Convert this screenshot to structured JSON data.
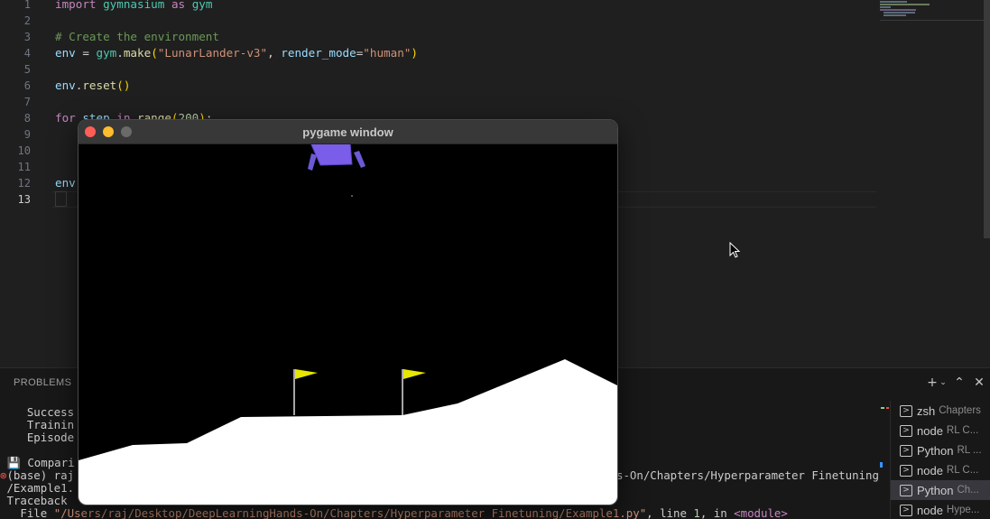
{
  "editor": {
    "line_numbers": [
      "1",
      "2",
      "3",
      "4",
      "5",
      "6",
      "7",
      "8",
      "9",
      "10",
      "11",
      "12",
      "13"
    ],
    "active_line": "13",
    "lines": {
      "l1": {
        "kw": "import",
        "mod": "gymnasium",
        "as": "as",
        "alias": "gym"
      },
      "l3": {
        "comment": "# Create the environment"
      },
      "l4": {
        "var": "env",
        "eq": " = ",
        "obj": "gym",
        "dot": ".",
        "fn": "make",
        "open": "(",
        "str1": "\"LunarLander-v3\"",
        "comma": ", ",
        "kw": "render_mode",
        "eq2": "=",
        "str2": "\"human\"",
        "close": ")"
      },
      "l6": {
        "var": "env",
        "dot": ".",
        "fn": "reset",
        "parens": "()"
      },
      "l8": {
        "kw": "for",
        "var": " step ",
        "in": "in",
        "fn": " range",
        "open": "(",
        "num": "200",
        "close": ")",
        "colon": ":"
      },
      "l12": {
        "var": "env"
      }
    }
  },
  "panel": {
    "tab_label": "PROBLEMS",
    "actions": {
      "add": "+",
      "dropdown": "⌄",
      "maximize": "⌃",
      "close": "✕"
    },
    "terminal_lines": [
      "    Success",
      "    Trainin",
      "    Episode",
      "",
      " 💾 Compari"
    ],
    "prompt": {
      "dot": "⊗",
      "text": "(base) raj",
      "tail": "s-On/Chapters/Hyperparameter Finetuning"
    },
    "cont": " /Example1.",
    "traceback": " Traceback",
    "file_line": {
      "prefix": "   File ",
      "path": "\"/Users/raj/Desktop/DeepLearningHands-On/Chapters/Hyperparameter Finetuning/Example1.py\"",
      "mid": ", line ",
      "num": "1",
      "mid2": ", in ",
      "module": "<module>"
    },
    "terminals": [
      {
        "name": "zsh",
        "desc": "Chapters",
        "selected": false
      },
      {
        "name": "node",
        "desc": "RL C...",
        "selected": false
      },
      {
        "name": "Python",
        "desc": "RL ...",
        "selected": false
      },
      {
        "name": "node",
        "desc": "RL C...",
        "selected": false
      },
      {
        "name": "Python",
        "desc": "Ch...",
        "selected": true
      },
      {
        "name": "node",
        "desc": "Hype...",
        "selected": false
      }
    ]
  },
  "pygame": {
    "title": "pygame window",
    "colors": {
      "lander": "#7a5de8",
      "flag": "#e6e600",
      "ground": "#ffffff",
      "sky": "#000000"
    }
  }
}
